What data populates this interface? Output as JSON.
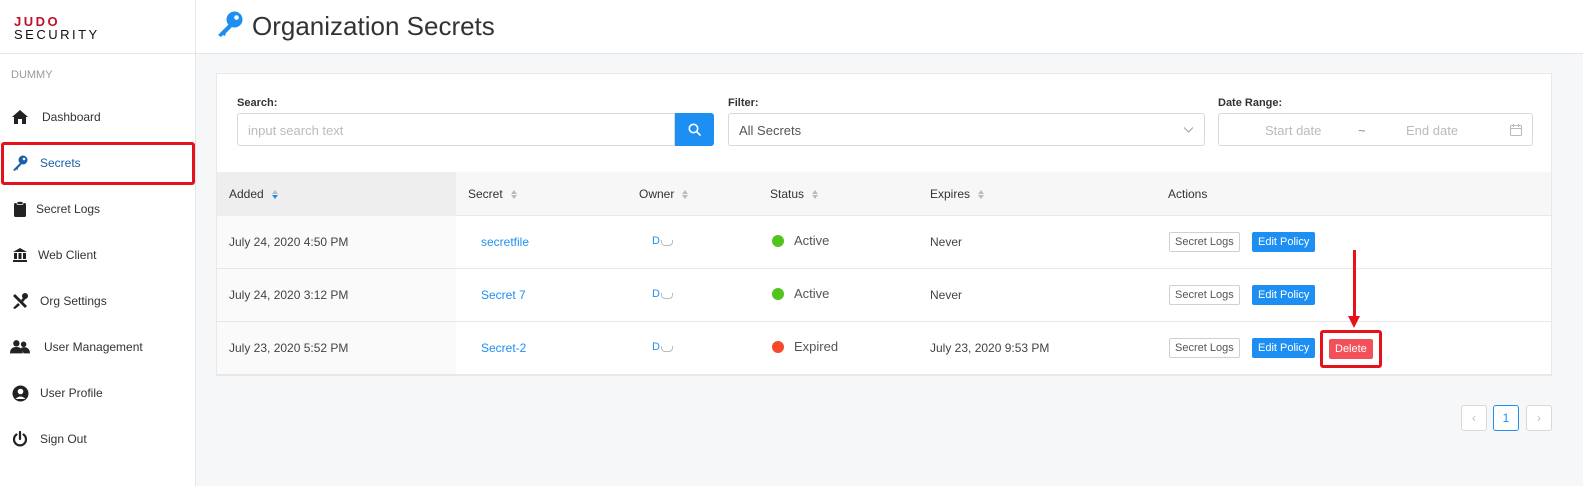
{
  "brand": {
    "line1": "JUDO",
    "line2": "SECURITY",
    "accent": "#c0102a"
  },
  "org_name": "DUMMY",
  "nav": [
    {
      "label": "Dashboard",
      "icon": "home-icon"
    },
    {
      "label": "Secrets",
      "icon": "key-icon",
      "active": true
    },
    {
      "label": "Secret Logs",
      "icon": "clipboard-icon"
    },
    {
      "label": "Web Client",
      "icon": "web-client-icon"
    },
    {
      "label": "Org Settings",
      "icon": "tools-icon"
    },
    {
      "label": "User Management",
      "icon": "users-icon"
    },
    {
      "label": "User Profile",
      "icon": "user-circle-icon"
    },
    {
      "label": "Sign Out",
      "icon": "power-icon"
    }
  ],
  "page": {
    "title": "Organization Secrets"
  },
  "filters": {
    "search_label": "Search:",
    "search_placeholder": "input search text",
    "filter_label": "Filter:",
    "filter_value": "All Secrets",
    "date_label": "Date Range:",
    "start_placeholder": "Start date",
    "date_sep": "~",
    "end_placeholder": "End date"
  },
  "table": {
    "columns": [
      "Added",
      "Secret",
      "Owner",
      "Status",
      "Expires",
      "Actions"
    ],
    "rows": [
      {
        "added": "July 24, 2020 4:50 PM",
        "secret": "secretfile",
        "owner": "D",
        "status": "Active",
        "status_color": "#52c41a",
        "expires": "Never",
        "actions": [
          "Secret Logs",
          "Edit Policy"
        ]
      },
      {
        "added": "July 24, 2020 3:12 PM",
        "secret": "Secret 7",
        "owner": "D",
        "status": "Active",
        "status_color": "#52c41a",
        "expires": "Never",
        "actions": [
          "Secret Logs",
          "Edit Policy"
        ]
      },
      {
        "added": "July 23, 2020 5:52 PM",
        "secret": "Secret-2",
        "owner": "D",
        "status": "Expired",
        "status_color": "#f5492c",
        "expires": "July 23, 2020 9:53 PM",
        "actions": [
          "Secret Logs",
          "Edit Policy",
          "Delete"
        ]
      }
    ]
  },
  "pagination": {
    "current": "1",
    "prev": "‹",
    "next": "›"
  },
  "colors": {
    "primary": "#1e8ff2",
    "danger": "#f2515a",
    "highlight": "#e3121b"
  }
}
